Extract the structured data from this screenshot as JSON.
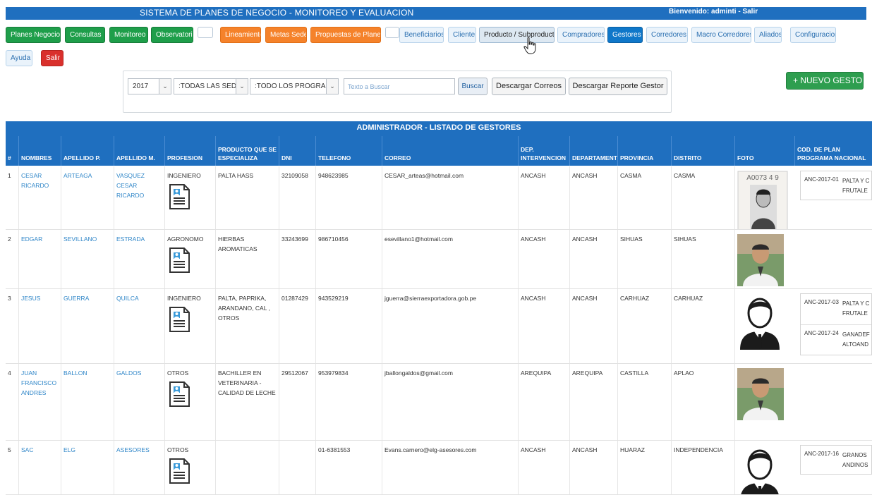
{
  "header": {
    "title": "SISTEMA DE PLANES DE NEGOCIO - MONITOREO Y EVALUACION",
    "welcome": "Bienvenido: adminti - Salir"
  },
  "nav": {
    "row1": [
      {
        "label": "Planes Negocio",
        "style": "green"
      },
      {
        "label": "Consultas",
        "style": "green"
      },
      {
        "label": "Monitoreo",
        "style": "green"
      },
      {
        "label": "Observatorio",
        "style": "green"
      },
      {
        "label": "Lineamientos",
        "style": "orange"
      },
      {
        "label": "Metas Sedes",
        "style": "orange"
      },
      {
        "label": "Propuestas de Planes",
        "style": "orange"
      },
      {
        "label": "Beneficiarios",
        "style": "light"
      },
      {
        "label": "Cliente",
        "style": "light"
      },
      {
        "label": "Producto / Subproducto",
        "style": "hover"
      },
      {
        "label": "Compradores",
        "style": "light"
      },
      {
        "label": "Gestores",
        "style": "active"
      },
      {
        "label": "Corredores",
        "style": "light"
      },
      {
        "label": "Macro Corredores",
        "style": "light"
      },
      {
        "label": "Aliados",
        "style": "light"
      },
      {
        "label": "Configuracion",
        "style": "light"
      }
    ],
    "row2": [
      {
        "label": "Ayuda",
        "style": "light"
      },
      {
        "label": "Salir",
        "style": "red"
      }
    ]
  },
  "filters": {
    "year": "2017",
    "sede": ":TODAS LAS SEDE",
    "programa": ":TODO LOS PROGRAMA",
    "search_placeholder": "Texto a Buscar",
    "search_label": "Buscar",
    "download_emails": "Descargar Correos",
    "download_report": "Descargar Reporte Gestor"
  },
  "new_button": "+ NUEVO GESTOR",
  "table": {
    "title": "ADMINISTRADOR - LISTADO DE GESTORES",
    "columns": [
      "#",
      "NOMBRES",
      "APELLIDO P.",
      "APELLIDO M.",
      "PROFESION",
      "PRODUCTO QUE SE ESPECIALIZA",
      "DNI",
      "TELEFONO",
      "CORREO",
      "DEP. INTERVENCION",
      "DEPARTAMENTO",
      "PROVINCIA",
      "DISTRITO",
      "FOTO",
      "COD. DE PLAN PROGRAMA NACIONAL"
    ],
    "rows": [
      {
        "num": "1",
        "nombres": "CESAR RICARDO",
        "ap_p": "ARTEAGA",
        "ap_m": "VASQUEZ CESAR RICARDO",
        "profesion": "INGENIERO",
        "producto": "PALTA HASS",
        "dni": "32109058",
        "telefono": "948623985",
        "correo": "CESAR_arteas@hotmail.com",
        "dep_int": "ANCASH",
        "departamento": "ANCASH",
        "provincia": "CASMA",
        "distrito": "CASMA",
        "foto": "document",
        "photo_text": "A0073 4 9",
        "plans": [
          {
            "code": "ANC-2017-01",
            "name": "PALTA Y C FRUTALE"
          }
        ]
      },
      {
        "num": "2",
        "nombres": "EDGAR",
        "ap_p": "SEVILLANO",
        "ap_m": "ESTRADA",
        "profesion": "AGRONOMO",
        "producto": "HIERBAS AROMATICAS",
        "dni": "33243699",
        "telefono": "986710456",
        "correo": "esevillano1@hotmail.com",
        "dep_int": "ANCASH",
        "departamento": "ANCASH",
        "provincia": "SIHUAS",
        "distrito": "SIHUAS",
        "foto": "photo",
        "plans": []
      },
      {
        "num": "3",
        "nombres": "JESUS",
        "ap_p": "GUERRA",
        "ap_m": "QUILCA",
        "profesion": "INGENIERO",
        "producto": "PALTA, PAPRIKA, ARANDANO, CAL , OTROS",
        "dni": "01287429",
        "telefono": "943529219",
        "correo": "jguerra@sierraexportadora.gob.pe",
        "dep_int": "ANCASH",
        "departamento": "ANCASH",
        "provincia": "CARHUAZ",
        "distrito": "CARHUAZ",
        "foto": "avatar",
        "plans": [
          {
            "code": "ANC-2017-03",
            "name": "PALTA Y C FRUTALE"
          },
          {
            "code": "ANC-2017-24",
            "name": "GANADEF ALTOAND"
          }
        ]
      },
      {
        "num": "4",
        "nombres": "JUAN FRANCISCO ANDRES",
        "ap_p": "BALLON",
        "ap_m": "GALDOS",
        "profesion": "OTROS",
        "producto": "BACHILLER EN VETERINARIA - CALIDAD DE LECHE",
        "dni": "29512067",
        "telefono": "953979834",
        "correo": "jballongaldos@gmail.com",
        "dep_int": "AREQUIPA",
        "departamento": "AREQUIPA",
        "provincia": "CASTILLA",
        "distrito": "APLAO",
        "foto": "photo",
        "plans": []
      },
      {
        "num": "5",
        "nombres": "SAC",
        "ap_p": "ELG",
        "ap_m": "ASESORES",
        "profesion": "OTROS",
        "producto": "",
        "dni": "",
        "telefono": "01-6381553",
        "correo": "Evans.carnero@elg-asesores.com",
        "dep_int": "ANCASH",
        "departamento": "ANCASH",
        "provincia": "HUARAZ",
        "distrito": "INDEPENDENCIA",
        "foto": "avatar",
        "plans": [
          {
            "code": "ANC-2017-16",
            "name": "GRANOS ANDINOS"
          }
        ]
      }
    ]
  },
  "colors": {
    "primary": "#1f6fbf",
    "green": "#1e9e4a",
    "orange": "#f5822a",
    "red": "#d9302c",
    "link": "#2f86c8"
  },
  "icons": [
    "document-icon",
    "hand-cursor-icon",
    "plus-icon",
    "chevron-down-icon",
    "user-avatar-icon"
  ]
}
